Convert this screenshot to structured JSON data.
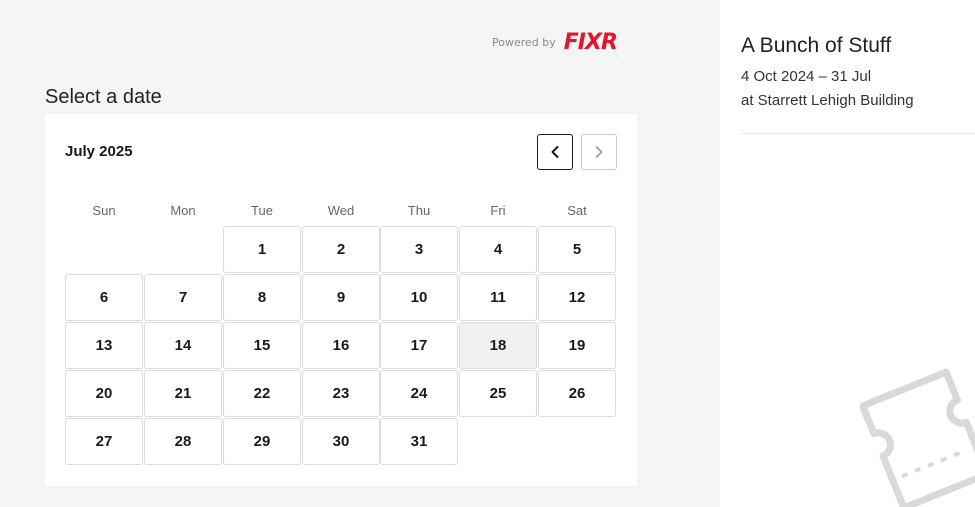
{
  "branding": {
    "powered_by": "Powered by",
    "logo_text": "FIXR"
  },
  "calendar": {
    "heading": "Select a date",
    "month": "July 2025",
    "weekdays": [
      "Sun",
      "Mon",
      "Tue",
      "Wed",
      "Thu",
      "Fri",
      "Sat"
    ],
    "days": [
      "1",
      "2",
      "3",
      "4",
      "5",
      "6",
      "7",
      "8",
      "9",
      "10",
      "11",
      "12",
      "13",
      "14",
      "15",
      "16",
      "17",
      "18",
      "19",
      "20",
      "21",
      "22",
      "23",
      "24",
      "25",
      "26",
      "27",
      "28",
      "29",
      "30",
      "31"
    ],
    "selected_day": "18"
  },
  "event": {
    "title": "A Bunch of Stuff",
    "dates": "4 Oct 2024 – 31 Jul",
    "venue": "at Starrett Lehigh Building"
  },
  "icons": {
    "prev": "chevron-left-icon",
    "next": "chevron-right-icon",
    "decoration": "ticket-icon"
  },
  "colors": {
    "brand": "#e5142c",
    "background": "#f5f5f5",
    "selected_day_bg": "#f0f0f0"
  }
}
